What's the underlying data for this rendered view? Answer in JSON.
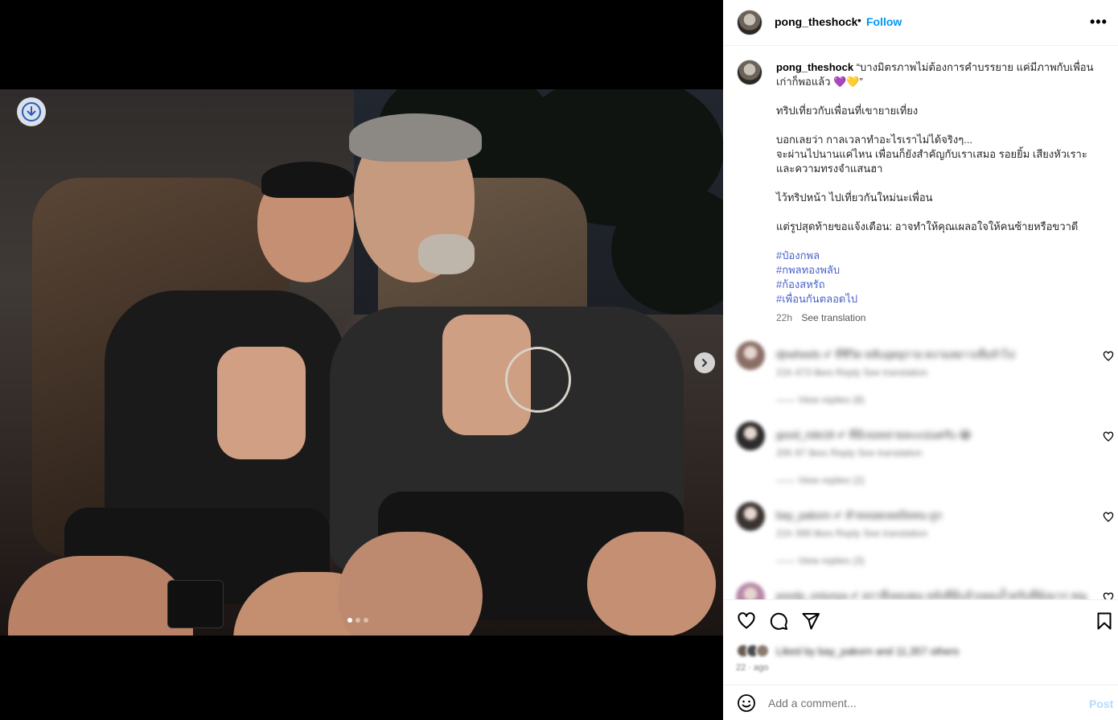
{
  "header": {
    "username": "pong_theshock",
    "separator": "•",
    "follow_label": "Follow",
    "more_label": "•••"
  },
  "media": {
    "carousel_count": 3,
    "active_index": 1
  },
  "caption": {
    "username": "pong_theshock",
    "lines": [
      "“บางมิตรภาพไม่ต้องการคำบรรยาย แค่มีภาพกับเพื่อนเก่าก็พอแล้ว 💜💛”",
      "",
      "ทริปเที่ยวกับเพื่อนที่เขายายเที่ยง",
      "",
      "บอกเลยว่า กาลเวลาทำอะไรเราไม่ได้จริงๆ...",
      "จะผ่านไปนานแค่ไหน เพื่อนก็ยังสำคัญกับเราเสมอ รอยยิ้ม เสียงหัวเราะและความทรงจำแสนฮา",
      "",
      "ไว้ทริปหน้า ไปเที่ยวกันใหม่นะเพื่อน",
      "",
      "แต่รูปสุดท้ายขอแจ้งเตือน: อาจทำให้คุณเผลอใจให้คนซ้ายหรือขวาดี",
      ""
    ],
    "hashtags": [
      "#ป๋องกพล",
      "#กพลทองพลับ",
      "#ก้องสหรัถ",
      "#เพื่อนกันตลอดไป"
    ],
    "time": "22h",
    "see_translation": "See translation"
  },
  "comments": [
    {
      "text": "dj•wheels ✔ ที่ชีวิต หลับอุดยุกาย คงามลยาวเทื่อจำไป",
      "meta": "21h  473 likes  Reply  See translation",
      "replies": "——  View replies (8)",
      "avatar_color": "#8a6f66"
    },
    {
      "text": "good_ride18 ✔ ที่มีเจอหลายละแน่นครับ 😂",
      "meta": "20h  97 likes  Reply  See translation",
      "replies": "——  View replies (2)",
      "avatar_color": "#2b2b2b"
    },
    {
      "text": "bay_pakorn ✔ สำหลอดเพลงิลหน ถูก",
      "meta": "21h  399 likes  Reply  See translation",
      "replies": "——  View replies (3)",
      "avatar_color": "#3a3330"
    },
    {
      "text": "poody_ontunya ✔ ยกาที่เพลงคุน หลังที่มีแล้วเพลงง้ำครับที่ทุ้งมาก หญู",
      "meta": "",
      "replies": "",
      "avatar_color": "#b88aa8"
    }
  ],
  "actions": {
    "liked_by": "Liked by bay_pakorn and 11,357 others",
    "age": "22 ·  ago"
  },
  "comment_box": {
    "placeholder": "Add a comment...",
    "post_label": "Post"
  },
  "colors": {
    "accent": "#0095f6",
    "hashtag": "#4a61c7",
    "muted": "#737373"
  },
  "icons": {
    "download": "download-icon",
    "next": "chevron-right-icon",
    "like": "heart-icon",
    "comment": "comment-icon",
    "share": "share-icon",
    "save": "bookmark-icon",
    "emoji": "emoji-icon",
    "more": "more-icon"
  }
}
